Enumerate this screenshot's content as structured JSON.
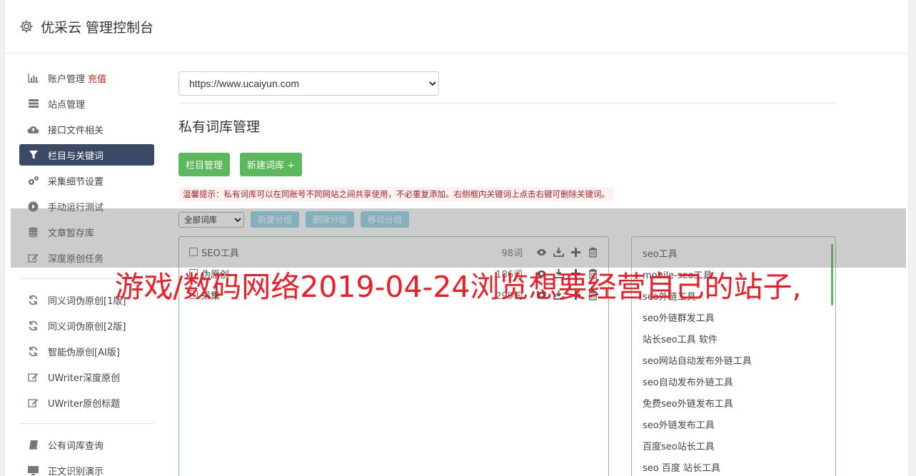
{
  "header": {
    "title": "优采云 管理控制台"
  },
  "sidebar": {
    "group1": [
      {
        "label": "账户管理",
        "badge": "充值",
        "icon": "bar-chart-icon"
      },
      {
        "label": "站点管理",
        "icon": "server-icon"
      },
      {
        "label": "接口文件相关",
        "icon": "cloud-upload-icon"
      },
      {
        "label": "栏目与关键词",
        "icon": "filter-icon",
        "active": true
      },
      {
        "label": "采集细节设置",
        "icon": "gears-icon"
      },
      {
        "label": "手动运行测试",
        "icon": "play-icon"
      },
      {
        "label": "文章暂存库",
        "icon": "database-icon"
      },
      {
        "label": "深度原创任务",
        "icon": "edit-icon"
      }
    ],
    "group2": [
      {
        "label": "同义词伪原创[1版]",
        "icon": "refresh-icon"
      },
      {
        "label": "同义词伪原创[2版]",
        "icon": "refresh-icon"
      },
      {
        "label": "智能伪原创[AI版]",
        "icon": "refresh-icon"
      },
      {
        "label": "UWriter深度原创",
        "icon": "edit-icon"
      },
      {
        "label": "UWriter原创标题",
        "icon": "edit-icon"
      }
    ],
    "group3": [
      {
        "label": "公有词库查询",
        "icon": "book-icon"
      },
      {
        "label": "正文识别演示",
        "icon": "monitor-icon"
      }
    ]
  },
  "main": {
    "site_select": "https://www.ucaiyun.com",
    "section_title": "私有词库管理",
    "btn_columns": "栏目管理",
    "btn_new_lib": "新建词库 +",
    "tip": "温馨提示：私有词库可以在同账号不同网站之间共享使用，不必重复添加。右侧框内关键词上点击右键可删除关键词。",
    "group_select": "全部词库",
    "btn_new_group": "新建分组",
    "btn_delete_group": "删除分组",
    "btn_move_group": "移动分组",
    "libraries": [
      {
        "name": "SEO工具",
        "count": "98词"
      },
      {
        "name": "伪原创",
        "count": "186词"
      },
      {
        "name": "采集",
        "count": "299词"
      }
    ],
    "keywords": [
      "seo工具",
      "mobile-seo工具",
      "seo外链工具",
      "seo外链群发工具",
      "站长seo工具 软件",
      "seo网站自动发布外链工具",
      "seo自动发布外链工具",
      "免费seo外链发布工具",
      "seo外链发布工具",
      "百度seo站长工具",
      "seo 百度 站长工具"
    ]
  },
  "overlay": {
    "text": "游戏/数码网络2019-04-24浏览想要经营自己的站子,"
  },
  "colors": {
    "accent_green": "#5cb85c",
    "active_nav": "#3a4a66",
    "overlay_red": "#ee1c25"
  }
}
